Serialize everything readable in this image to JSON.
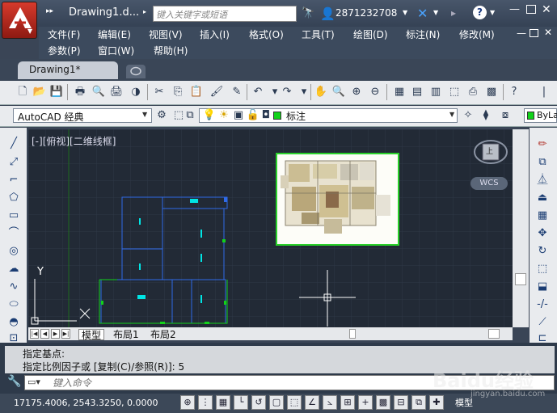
{
  "window": {
    "title": "Drawing1.d...",
    "search_placeholder": "键入关键字或短语",
    "user_id": "2871232708"
  },
  "menu": {
    "items": [
      "文件(F)",
      "编辑(E)",
      "视图(V)",
      "插入(I)",
      "格式(O)",
      "工具(T)",
      "绘图(D)",
      "标注(N)",
      "修改(M)",
      "参数(P)",
      "窗口(W)",
      "帮助(H)"
    ]
  },
  "tabs": {
    "document": "Drawing1*"
  },
  "toolbar2": {
    "workspace": "AutoCAD 经典",
    "layer": "标注",
    "color": "ByLa",
    "layer_color": "#12d21a"
  },
  "canvas": {
    "view_label": "[-][俯视][二维线框]",
    "wcs_label": "WCS",
    "viewcube_face": "上",
    "axis_y": "Y",
    "axis_x": "X",
    "layout_tabs": [
      "模型",
      "布局1",
      "布局2"
    ]
  },
  "command": {
    "line1": "指定基点:",
    "line2": "指定比例因子或 [复制(C)/参照(R)]: 5",
    "input_placeholder": "键入命令"
  },
  "status": {
    "coords": "17175.4006, 2543.3250, 0.0000",
    "model_label": "模型"
  },
  "watermark": {
    "text": "Baidu经验",
    "sub": "jingyan.baidu.com"
  },
  "colors": {
    "canvas_bg": "#222a36",
    "plan_lines": "#2f6ae8",
    "highlight": "#12d21a",
    "accent_cyan": "#00e5e5"
  }
}
